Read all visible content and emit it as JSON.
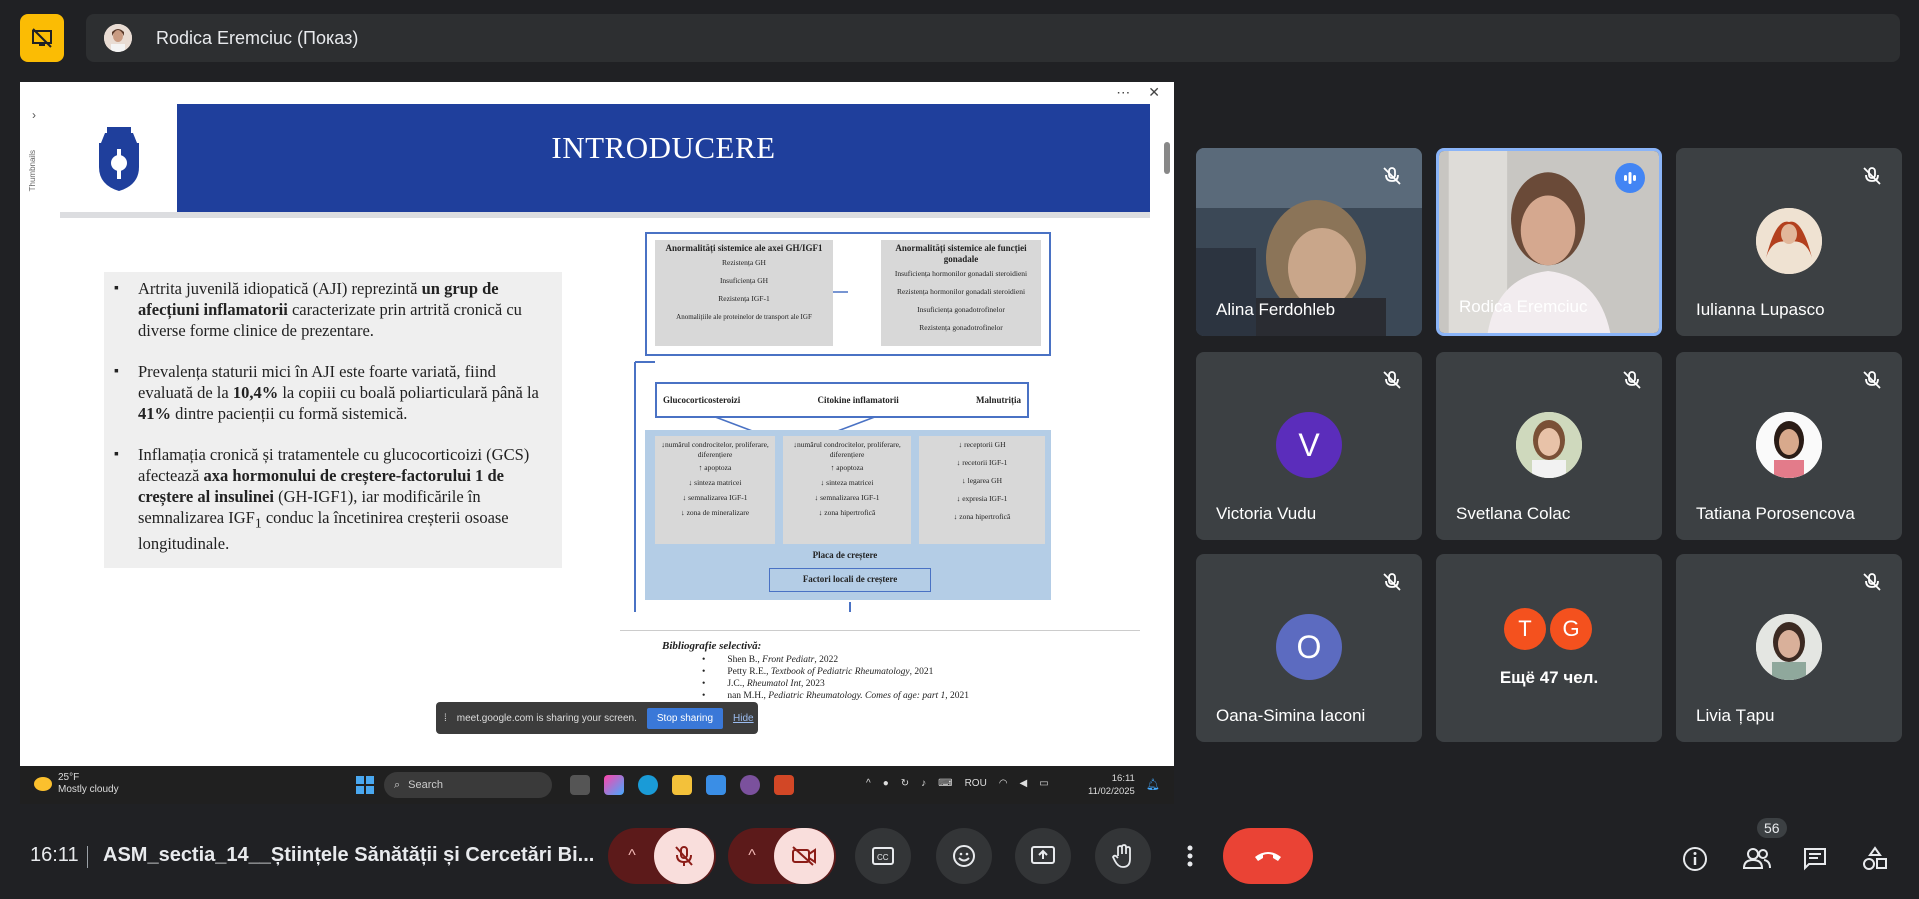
{
  "top": {
    "presenter_label": "Rodica Eremciuc (Показ)"
  },
  "slide": {
    "title": "INTRODUCERE",
    "bullets": [
      {
        "pre": "Artrita juvenilă idiopatică (AJI) reprezintă ",
        "b1": "un grup de afecțiuni inflamatorii",
        "post": " caracterizate prin artrită cronică cu diverse forme clinice de prezentare."
      },
      {
        "pre": "Prevalența staturii mici în AJI este foarte variată, fiind evaluată de la ",
        "b1": "10,4%",
        "mid": " la copiii cu boală poliarticulară până la ",
        "b2": "41%",
        "post": " dintre pacienții cu formă sistemică."
      },
      {
        "pre": "Inflamația cronică și tratamentele cu glucocorticoizi (GCS) afectează ",
        "b1": "axa hormonului de creștere-factorului 1 de creștere al insulinei",
        "mid": " (GH-IGF1), iar modificările în semnalizarea IGF",
        "sub": "1",
        "post": " conduc la încetinirea creșterii osoase longitudinale."
      }
    ],
    "diagram": {
      "box1_title": "Anormalități sistemice ale axei GH/IGF1",
      "box1_items": [
        "Rezistența GH",
        "Insuficiența GH",
        "Rezistența IGF-1",
        "Anomalițiile ale proteinelor de transport ale IGF"
      ],
      "box2_title": "Anormalități sistemice ale funcției gonadale",
      "box2_items": [
        "Insuficiența hormonilor gonadali steroidieni",
        "Rezistența hormonilor gonadali steroidieni",
        "Insuficiența gonadotrofinelor",
        "Rezistența gonadotrofinelor"
      ],
      "flow": [
        "Glucocorticosteroizi",
        "Citokine inflamatorii",
        "Malnutriția"
      ],
      "col1": [
        "↓numărul condrocitelor, proliferare, diferențiere",
        "↑ apoptoza",
        "↓ sinteza matricei",
        "↓ semnalizarea IGF-1",
        "↓ zona de mineralizare"
      ],
      "col2": [
        "↓numărul condrocitelor, proliferare, diferențiere",
        "↑ apoptoza",
        "↓ sinteza matricei",
        "↓ semnalizarea IGF-1",
        "↓ zona hipertrofică"
      ],
      "col3": [
        "↓ receptorii GH",
        "↓ recetorii IGF-1",
        "↓ legarea GH",
        "↓ expresia IGF-1",
        "↓ zona hipertrofică"
      ],
      "placa": "Placa de creștere",
      "factori": "Factori locali de creștere"
    },
    "biblio": {
      "title": "Bibliografie selectivă:",
      "items": [
        {
          "a": "Shen B., ",
          "i": "Front Pediatr",
          "y": ", 2022"
        },
        {
          "a": "Petty R.E., ",
          "i": "Textbook of Pediatric Rheumatology",
          "y": ", 2021"
        },
        {
          "a": "J.C., ",
          "i": "Rheumatol Int",
          "y": ", 2023"
        },
        {
          "a": "nan M.H., ",
          "i": "Pediatric Rheumatology. Comes of age: part 1",
          "y": ", 2021"
        }
      ]
    }
  },
  "screen_ui": {
    "thumbnails_label": "Thumbnails",
    "share_msg": "meet.google.com is sharing your screen.",
    "stop_sharing": "Stop sharing",
    "hide": "Hide"
  },
  "taskbar": {
    "temp": "25°F",
    "weather": "Mostly cloudy",
    "search": "Search",
    "lang": "ROU",
    "time": "16:11",
    "date": "11/02/2025"
  },
  "participants": [
    {
      "name": "Alina Ferdohleb",
      "type": "video",
      "muted": true
    },
    {
      "name": "Rodica Eremciuc",
      "type": "video",
      "muted": false,
      "speaking": true
    },
    {
      "name": "Iulianna Lupasco",
      "type": "photo",
      "muted": true
    },
    {
      "name": "Victoria Vudu",
      "type": "letter",
      "letter": "V",
      "color": "#5b2dbb",
      "muted": true
    },
    {
      "name": "Svetlana Colac",
      "type": "photo",
      "muted": true
    },
    {
      "name": "Tatiana Porosencova",
      "type": "photo",
      "muted": true
    },
    {
      "name": "Oana-Simina Iaconi",
      "type": "letter",
      "letter": "O",
      "color": "#5c6bc0",
      "muted": true
    },
    {
      "name": "Ещё 47 чел.",
      "type": "group",
      "letters": [
        "T",
        "G"
      ]
    },
    {
      "name": "Livia Țapu",
      "type": "photo",
      "muted": true
    }
  ],
  "bottom": {
    "time": "16:11",
    "meeting": "ASM_sectia_14__Științele Sănătății și Cercetări Bi...",
    "people_count": "56"
  }
}
